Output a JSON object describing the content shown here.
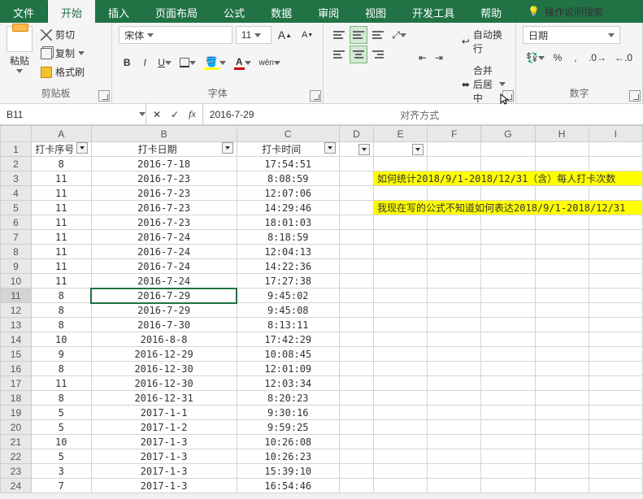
{
  "menu": {
    "file": "文件",
    "home": "开始",
    "insert": "插入",
    "layout": "页面布局",
    "formula": "公式",
    "data": "数据",
    "review": "审阅",
    "view": "视图",
    "dev": "开发工具",
    "help": "帮助",
    "tell": "操作说明搜索"
  },
  "ribbon": {
    "clipboard": {
      "label": "剪贴板",
      "paste": "粘贴",
      "cut": "剪切",
      "copy": "复制",
      "painter": "格式刷"
    },
    "font": {
      "label": "字体",
      "name": "宋体",
      "size": "11",
      "wen": "wén"
    },
    "align": {
      "label": "对齐方式",
      "wrap": "自动换行",
      "merge": "合并后居中"
    },
    "number": {
      "label": "数字",
      "format": "日期",
      "percent": "%",
      "comma": ","
    }
  },
  "namebox": "B11",
  "formula": "2016-7-29",
  "cols": [
    "A",
    "B",
    "C",
    "D",
    "E",
    "F",
    "G",
    "H",
    "I"
  ],
  "headers": {
    "a": "打卡序号",
    "b": "打卡日期",
    "c": "打卡时间"
  },
  "rows": [
    {
      "n": 1
    },
    {
      "n": 2,
      "a": "8",
      "b": "2016-7-18",
      "c": "17:54:51"
    },
    {
      "n": 3,
      "a": "11",
      "b": "2016-7-23",
      "c": "8:08:59"
    },
    {
      "n": 4,
      "a": "11",
      "b": "2016-7-23",
      "c": "12:07:06"
    },
    {
      "n": 5,
      "a": "11",
      "b": "2016-7-23",
      "c": "14:29:46"
    },
    {
      "n": 6,
      "a": "11",
      "b": "2016-7-23",
      "c": "18:01:03"
    },
    {
      "n": 7,
      "a": "11",
      "b": "2016-7-24",
      "c": "8:18:59"
    },
    {
      "n": 8,
      "a": "11",
      "b": "2016-7-24",
      "c": "12:04:13"
    },
    {
      "n": 9,
      "a": "11",
      "b": "2016-7-24",
      "c": "14:22:36"
    },
    {
      "n": 10,
      "a": "11",
      "b": "2016-7-24",
      "c": "17:27:38"
    },
    {
      "n": 11,
      "a": "8",
      "b": "2016-7-29",
      "c": "9:45:02"
    },
    {
      "n": 12,
      "a": "8",
      "b": "2016-7-29",
      "c": "9:45:08"
    },
    {
      "n": 13,
      "a": "8",
      "b": "2016-7-30",
      "c": "8:13:11"
    },
    {
      "n": 14,
      "a": "10",
      "b": "2016-8-8",
      "c": "17:42:29"
    },
    {
      "n": 15,
      "a": "9",
      "b": "2016-12-29",
      "c": "10:08:45"
    },
    {
      "n": 16,
      "a": "8",
      "b": "2016-12-30",
      "c": "12:01:09"
    },
    {
      "n": 17,
      "a": "11",
      "b": "2016-12-30",
      "c": "12:03:34"
    },
    {
      "n": 18,
      "a": "8",
      "b": "2016-12-31",
      "c": "8:20:23"
    },
    {
      "n": 19,
      "a": "5",
      "b": "2017-1-1",
      "c": "9:30:16"
    },
    {
      "n": 20,
      "a": "5",
      "b": "2017-1-2",
      "c": "9:59:25"
    },
    {
      "n": 21,
      "a": "10",
      "b": "2017-1-3",
      "c": "10:26:08"
    },
    {
      "n": 22,
      "a": "5",
      "b": "2017-1-3",
      "c": "10:26:23"
    },
    {
      "n": 23,
      "a": "3",
      "b": "2017-1-3",
      "c": "15:39:10"
    },
    {
      "n": 24,
      "a": "7",
      "b": "2017-1-3",
      "c": "16:54:46"
    }
  ],
  "notes": {
    "q": "如何统计2018/9/1-2018/12/31（含）每人打卡次数",
    "a": "我现在写的公式不知道如何表达2018/9/1-2018/12/31"
  }
}
